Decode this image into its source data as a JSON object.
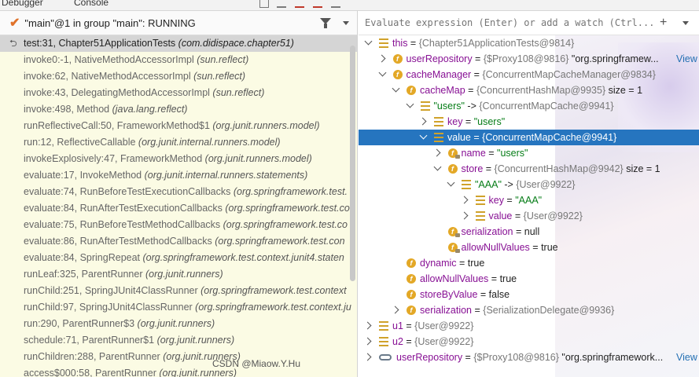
{
  "tabs": [
    "Debugger",
    "Console"
  ],
  "thread": {
    "title": "\"main\"@1 in group \"main\": RUNNING"
  },
  "frames": [
    {
      "loc": "test:31, Chapter51ApplicationTests",
      "pkg": "(com.didispace.chapter51)",
      "selected": true
    },
    {
      "loc": "invoke0:-1, NativeMethodAccessorImpl",
      "pkg": "(sun.reflect)"
    },
    {
      "loc": "invoke:62, NativeMethodAccessorImpl",
      "pkg": "(sun.reflect)"
    },
    {
      "loc": "invoke:43, DelegatingMethodAccessorImpl",
      "pkg": "(sun.reflect)"
    },
    {
      "loc": "invoke:498, Method",
      "pkg": "(java.lang.reflect)"
    },
    {
      "loc": "runReflectiveCall:50, FrameworkMethod$1",
      "pkg": "(org.junit.runners.model)"
    },
    {
      "loc": "run:12, ReflectiveCallable",
      "pkg": "(org.junit.internal.runners.model)"
    },
    {
      "loc": "invokeExplosively:47, FrameworkMethod",
      "pkg": "(org.junit.runners.model)"
    },
    {
      "loc": "evaluate:17, InvokeMethod",
      "pkg": "(org.junit.internal.runners.statements)"
    },
    {
      "loc": "evaluate:74, RunBeforeTestExecutionCallbacks",
      "pkg": "(org.springframework.test."
    },
    {
      "loc": "evaluate:84, RunAfterTestExecutionCallbacks",
      "pkg": "(org.springframework.test.co"
    },
    {
      "loc": "evaluate:75, RunBeforeTestMethodCallbacks",
      "pkg": "(org.springframework.test.co"
    },
    {
      "loc": "evaluate:86, RunAfterTestMethodCallbacks",
      "pkg": "(org.springframework.test.con"
    },
    {
      "loc": "evaluate:84, SpringRepeat",
      "pkg": "(org.springframework.test.context.junit4.staten"
    },
    {
      "loc": "runLeaf:325, ParentRunner",
      "pkg": "(org.junit.runners)"
    },
    {
      "loc": "runChild:251, SpringJUnit4ClassRunner",
      "pkg": "(org.springframework.test.context"
    },
    {
      "loc": "runChild:97, SpringJUnit4ClassRunner",
      "pkg": "(org.springframework.test.context.ju"
    },
    {
      "loc": "run:290, ParentRunner$3",
      "pkg": "(org.junit.runners)"
    },
    {
      "loc": "schedule:71, ParentRunner$1",
      "pkg": "(org.junit.runners)"
    },
    {
      "loc": "runChildren:288, ParentRunner",
      "pkg": "(org.junit.runners)"
    },
    {
      "loc": "access$000:58, ParentRunner",
      "pkg": "(org.junit.runners)"
    }
  ],
  "evaluate": {
    "placeholder": "Evaluate expression (Enter) or add a watch (Ctrl..."
  },
  "variables": [
    {
      "depth": 0,
      "arrow": "open",
      "icon": "eq",
      "name": "this",
      "op": " = ",
      "type": "{Chapter51ApplicationTests@9814}",
      "tail": ""
    },
    {
      "depth": 1,
      "arrow": "closed",
      "icon": "f",
      "name": "userRepository",
      "op": " = ",
      "type": "{$Proxy108@9816}",
      "tail": " \"org.springframew...",
      "link": "View"
    },
    {
      "depth": 1,
      "arrow": "open",
      "icon": "f",
      "name": "cacheManager",
      "op": " = ",
      "type": "{ConcurrentMapCacheManager@9834}",
      "tail": ""
    },
    {
      "depth": 2,
      "arrow": "open",
      "icon": "f",
      "name": "cacheMap",
      "op": " = ",
      "type": "{ConcurrentHashMap@9935}",
      "tail": "  size = 1"
    },
    {
      "depth": 3,
      "arrow": "open",
      "icon": "eq",
      "name": "\"users\"",
      "nameStyle": "st",
      "op": " -> ",
      "type": "{ConcurrentMapCache@9941}",
      "tail": ""
    },
    {
      "depth": 4,
      "arrow": "closed",
      "icon": "eq",
      "name": "key",
      "op": " = ",
      "value": "\"users\"",
      "valueStyle": "st"
    },
    {
      "depth": 4,
      "arrow": "open",
      "icon": "eq",
      "name": "value",
      "op": " = ",
      "type": "{ConcurrentMapCache@9941}",
      "selected": true
    },
    {
      "depth": 5,
      "arrow": "closed",
      "icon": "fl",
      "name": "name",
      "op": " = ",
      "value": "\"users\"",
      "valueStyle": "st"
    },
    {
      "depth": 5,
      "arrow": "open",
      "icon": "f",
      "name": "store",
      "op": " = ",
      "type": "{ConcurrentHashMap@9942}",
      "tail": "  size = 1"
    },
    {
      "depth": 6,
      "arrow": "open",
      "icon": "eq",
      "name": "\"AAA\"",
      "nameStyle": "st",
      "op": " -> ",
      "type": "{User@9922}",
      "tail": ""
    },
    {
      "depth": 7,
      "arrow": "closed",
      "icon": "eq",
      "name": "key",
      "op": " = ",
      "value": "\"AAA\"",
      "valueStyle": "st"
    },
    {
      "depth": 7,
      "arrow": "closed",
      "icon": "eq",
      "name": "value",
      "op": " = ",
      "type": "{User@9922}",
      "tail": ""
    },
    {
      "depth": 5,
      "arrow": "",
      "icon": "fl",
      "name": "serialization",
      "op": " = ",
      "value": "null"
    },
    {
      "depth": 5,
      "arrow": "",
      "icon": "fl",
      "name": "allowNullValues",
      "op": " = ",
      "value": "true"
    },
    {
      "depth": 2,
      "arrow": "",
      "icon": "f",
      "name": "dynamic",
      "op": " = ",
      "value": "true"
    },
    {
      "depth": 2,
      "arrow": "",
      "icon": "f",
      "name": "allowNullValues",
      "op": " = ",
      "value": "true"
    },
    {
      "depth": 2,
      "arrow": "",
      "icon": "f",
      "name": "storeByValue",
      "op": " = ",
      "value": "false"
    },
    {
      "depth": 2,
      "arrow": "closed",
      "icon": "f",
      "name": "serialization",
      "op": " = ",
      "type": "{SerializationDelegate@9936}",
      "tail": ""
    },
    {
      "depth": 0,
      "arrow": "closed",
      "icon": "eq",
      "name": "u1",
      "op": " = ",
      "type": "{User@9922}",
      "tail": ""
    },
    {
      "depth": 0,
      "arrow": "closed",
      "icon": "eq",
      "name": "u2",
      "op": " = ",
      "type": "{User@9922}",
      "tail": ""
    },
    {
      "depth": 0,
      "arrow": "closed",
      "icon": "oo",
      "name": "userRepository",
      "op": " = ",
      "type": "{$Proxy108@9816}",
      "tail": " \"org.springframework...",
      "link": "View"
    }
  ],
  "watermark": "CSDN @Miaow.Y.Hu"
}
